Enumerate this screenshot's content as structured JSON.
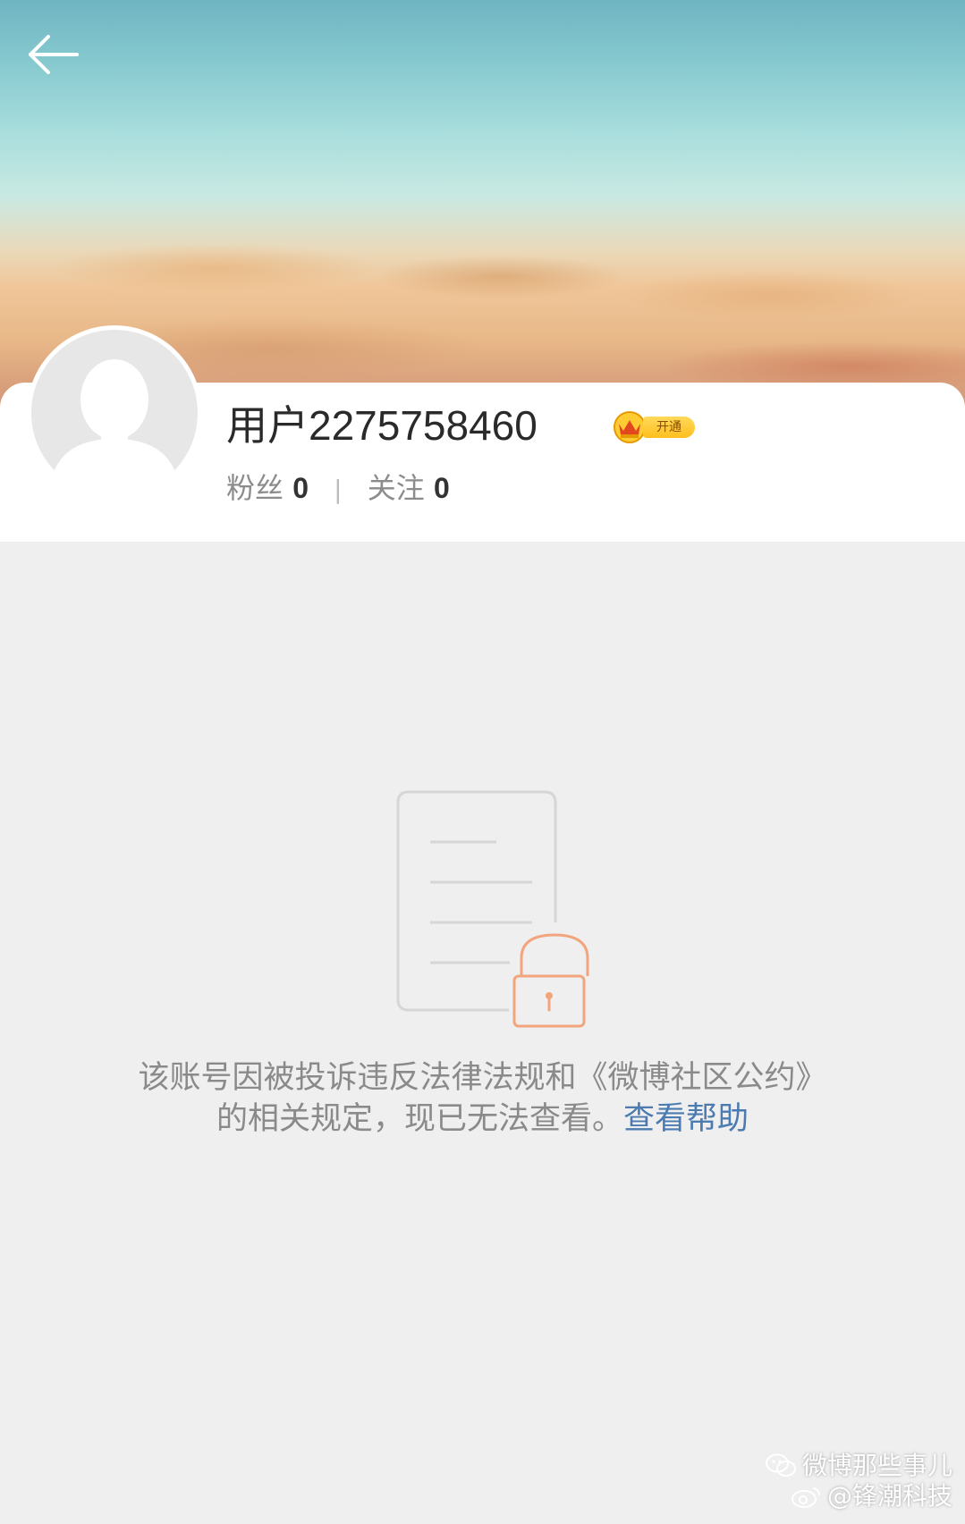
{
  "header": {
    "back_icon": "arrow-left-icon"
  },
  "profile": {
    "username": "用户2275758460",
    "vip_badge_label": "开通",
    "fans_label": "粉丝",
    "fans_count": "0",
    "separator": "|",
    "following_label": "关注",
    "following_count": "0"
  },
  "blocked_notice": {
    "icon": "locked-document-icon",
    "message_line1": "该账号因被投诉违反法律法规和《微博社区公约》",
    "message_line2": "的相关规定，现已无法查看。",
    "help_link": "查看帮助"
  },
  "watermark": {
    "line1": "微博那些事儿",
    "line2": "@锋潮科技"
  },
  "colors": {
    "background": "#efefef",
    "link": "#4b7bb0",
    "lock_orange": "#f2a57c",
    "text_gray": "#8a8a8a"
  }
}
